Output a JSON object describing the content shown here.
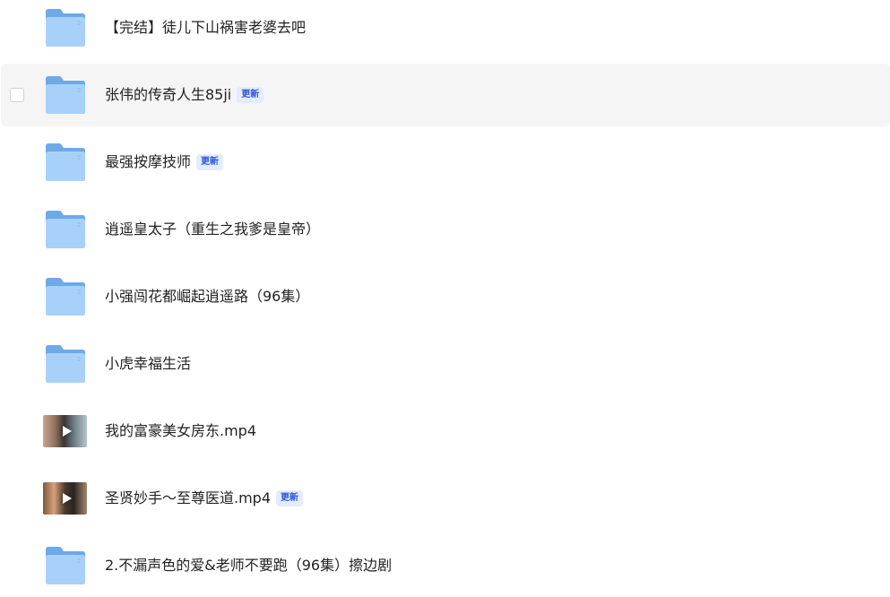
{
  "colors": {
    "hover_row_bg": "#f5f5f5",
    "folder_back": "#6ea9e8",
    "folder_front": "#a8d1fa",
    "badge_text": "#2b55d6",
    "badge_bg": "#e3ecff"
  },
  "icons": {
    "folder": "folder-icon",
    "video": "video-thumbnail-icon",
    "play": "play-icon"
  },
  "files": [
    {
      "name": "【完结】徒儿下山祸害老婆去吧",
      "type": "folder",
      "badge": ""
    },
    {
      "name": "张伟的传奇人生85ji",
      "type": "folder",
      "badge": "更新",
      "hovered": true
    },
    {
      "name": "最强按摩技师",
      "type": "folder",
      "badge": "更新"
    },
    {
      "name": "逍遥皇太子（重生之我爹是皇帝）",
      "type": "folder",
      "badge": ""
    },
    {
      "name": "小强闯花都崛起逍遥路（96集）",
      "type": "folder",
      "badge": ""
    },
    {
      "name": "小虎幸福生活",
      "type": "folder",
      "badge": ""
    },
    {
      "name": "我的富豪美女房东.mp4",
      "type": "video",
      "badge": ""
    },
    {
      "name": "圣贤妙手～至尊医道.mp4",
      "type": "video",
      "badge": "更新"
    },
    {
      "name": "2.不漏声色的爱&老师不要跑（96集）擦边剧",
      "type": "folder",
      "badge": ""
    }
  ]
}
